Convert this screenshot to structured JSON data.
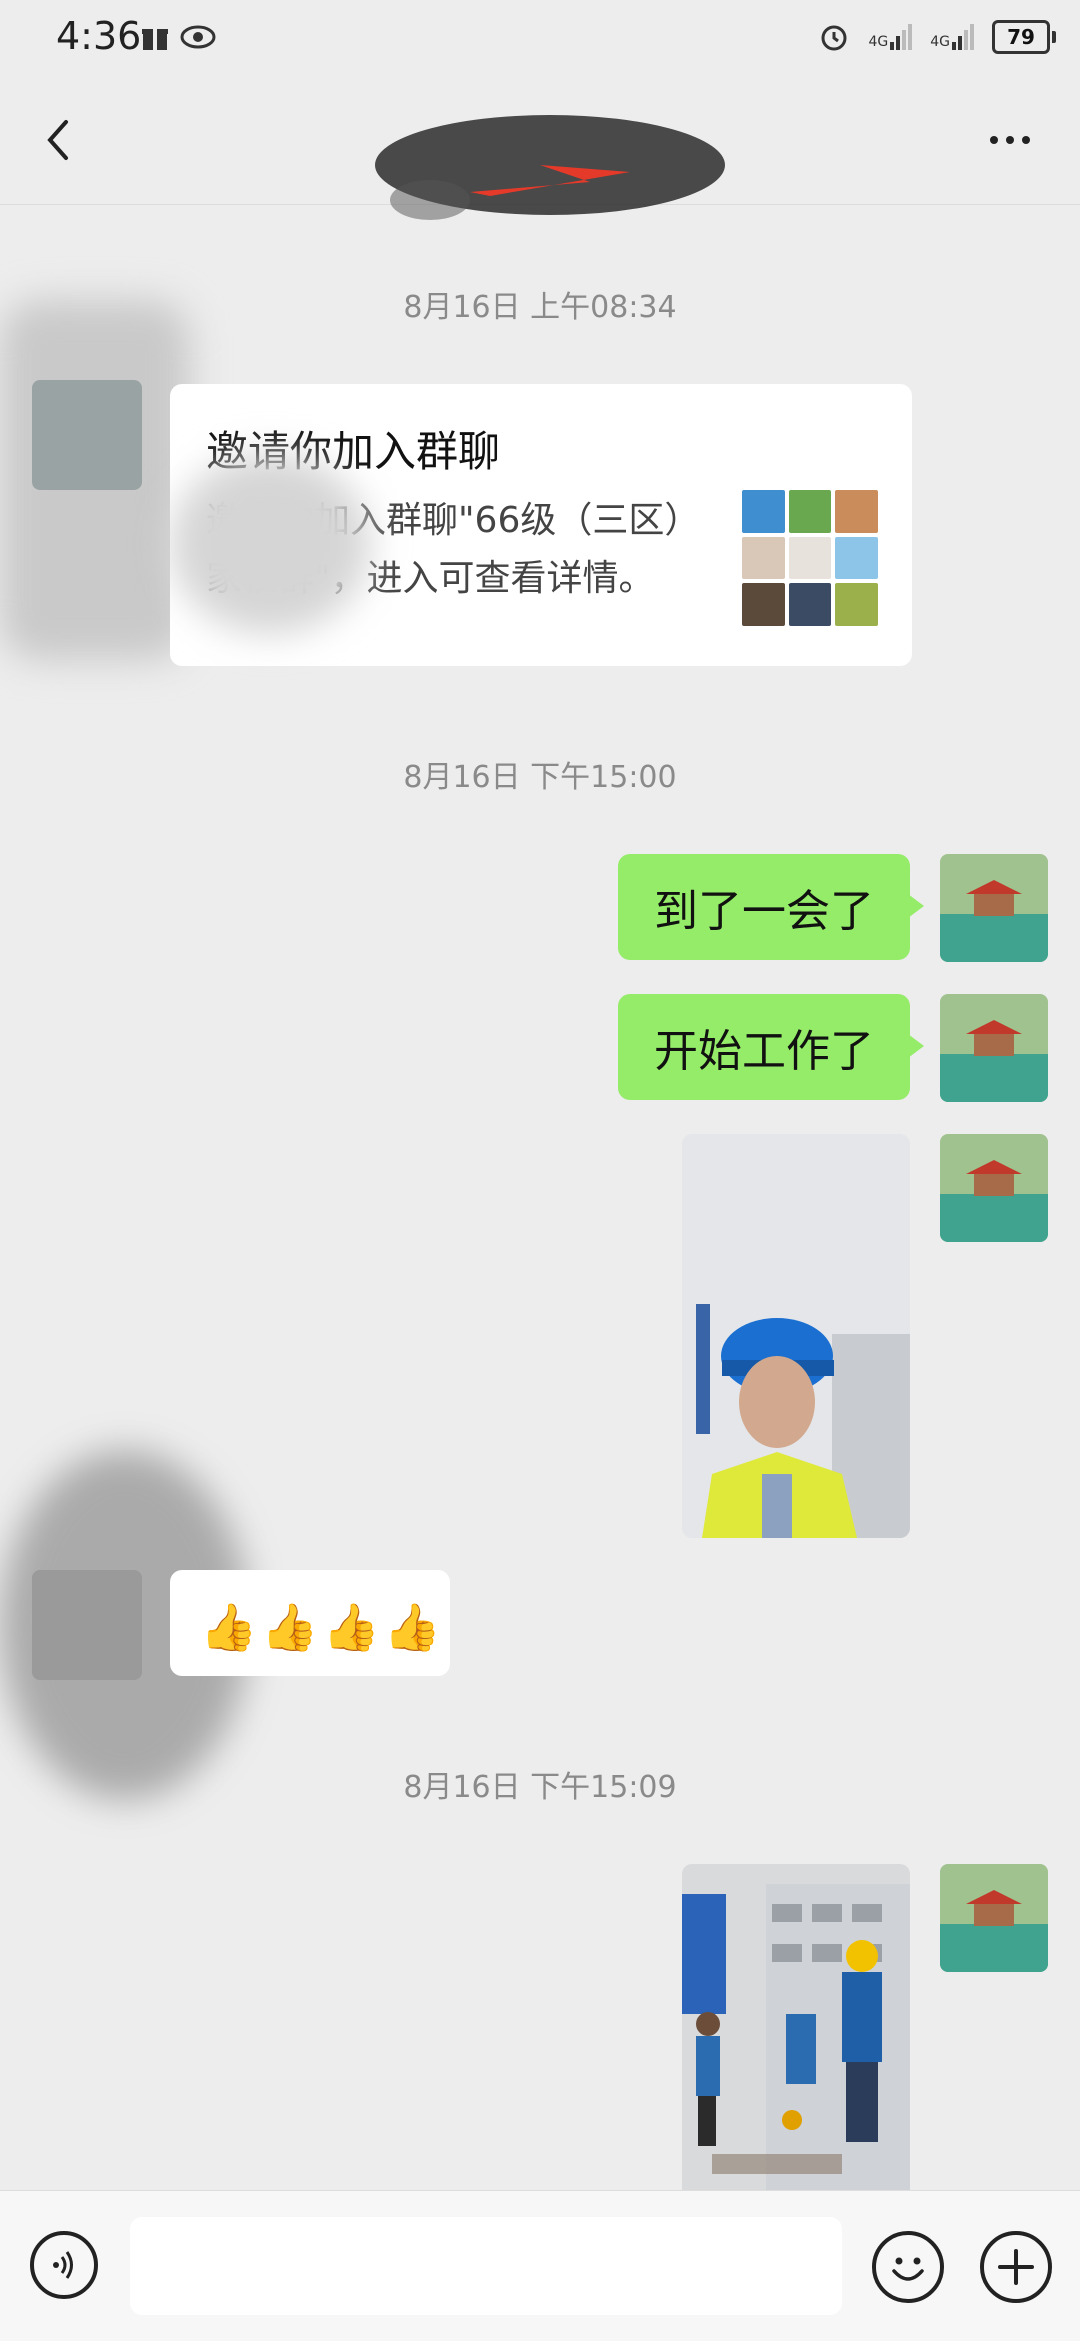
{
  "status_bar": {
    "time": "4:36",
    "network_1": "4G",
    "network_2": "4G",
    "battery": "79",
    "icons": [
      "gift-icon",
      "eye-icon",
      "alarm-icon",
      "signal-icon",
      "signal-icon",
      "battery-icon"
    ]
  },
  "nav": {
    "back_icon": "chevron-left-icon",
    "more_icon": "more-dots-icon",
    "title": ""
  },
  "timestamps": [
    "8月16日 上午08:34",
    "8月16日 下午15:00",
    "8月16日 下午15:09"
  ],
  "invite_card": {
    "title": "邀请你加入群聊",
    "text": "邀请你加入群聊\"66级（三区）家校群\"，进入可查看详情。"
  },
  "messages_sent": [
    {
      "text": "到了一会了"
    },
    {
      "text": "开始工作了"
    }
  ],
  "received_emoji": "👍👍👍👍",
  "input_bar": {
    "placeholder": "",
    "icons": [
      "voice-icon",
      "emoji-icon",
      "plus-icon"
    ]
  },
  "colors": {
    "background": "#ededed",
    "bubble_green": "#95ec69",
    "bubble_white": "#ffffff",
    "timestamp": "#8a8a8a"
  }
}
